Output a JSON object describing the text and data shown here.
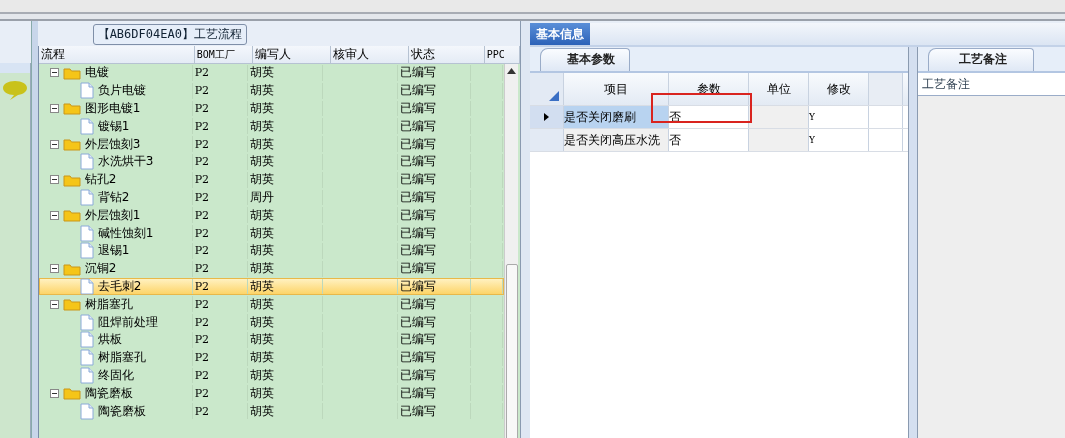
{
  "flow_panel": {
    "title": "【AB6DF04EA0】工艺流程",
    "columns": [
      "流程",
      "BOM工厂",
      "编写人",
      "核审人",
      "状态",
      "PPC"
    ],
    "rows": [
      {
        "name": "电镀",
        "bom": "P2",
        "author": "胡英",
        "status": "已编写",
        "kind": "folder",
        "selected": false,
        "children": [
          {
            "name": "负片电镀",
            "bom": "P2",
            "author": "胡英",
            "status": "已编写",
            "kind": "file",
            "selected": false
          }
        ]
      },
      {
        "name": "图形电镀1",
        "bom": "P2",
        "author": "胡英",
        "status": "已编写",
        "kind": "folder",
        "selected": false,
        "children": [
          {
            "name": "镀锡1",
            "bom": "P2",
            "author": "胡英",
            "status": "已编写",
            "kind": "file",
            "selected": false
          }
        ]
      },
      {
        "name": "外层蚀刻3",
        "bom": "P2",
        "author": "胡英",
        "status": "已编写",
        "kind": "folder",
        "selected": false,
        "children": [
          {
            "name": "水洗烘干3",
            "bom": "P2",
            "author": "胡英",
            "status": "已编写",
            "kind": "file",
            "selected": false
          }
        ]
      },
      {
        "name": "钻孔2",
        "bom": "P2",
        "author": "胡英",
        "status": "已编写",
        "kind": "folder",
        "selected": false,
        "children": [
          {
            "name": "背钻2",
            "bom": "P2",
            "author": "周丹",
            "status": "已编写",
            "kind": "file",
            "selected": false
          }
        ]
      },
      {
        "name": "外层蚀刻1",
        "bom": "P2",
        "author": "胡英",
        "status": "已编写",
        "kind": "folder",
        "selected": false,
        "children": [
          {
            "name": "碱性蚀刻1",
            "bom": "P2",
            "author": "胡英",
            "status": "已编写",
            "kind": "file",
            "selected": false
          },
          {
            "name": "退锡1",
            "bom": "P2",
            "author": "胡英",
            "status": "已编写",
            "kind": "file",
            "selected": false
          }
        ]
      },
      {
        "name": "沉铜2",
        "bom": "P2",
        "author": "胡英",
        "status": "已编写",
        "kind": "folder",
        "selected": false,
        "children": [
          {
            "name": "去毛刺2",
            "bom": "P2",
            "author": "胡英",
            "status": "已编写",
            "kind": "file",
            "selected": true
          }
        ]
      },
      {
        "name": "树脂塞孔",
        "bom": "P2",
        "author": "胡英",
        "status": "已编写",
        "kind": "folder",
        "selected": false,
        "children": [
          {
            "name": "阻焊前处理",
            "bom": "P2",
            "author": "胡英",
            "status": "已编写",
            "kind": "file",
            "selected": false
          },
          {
            "name": "烘板",
            "bom": "P2",
            "author": "胡英",
            "status": "已编写",
            "kind": "file",
            "selected": false
          },
          {
            "name": "树脂塞孔",
            "bom": "P2",
            "author": "胡英",
            "status": "已编写",
            "kind": "file",
            "selected": false
          },
          {
            "name": "终固化",
            "bom": "P2",
            "author": "胡英",
            "status": "已编写",
            "kind": "file",
            "selected": false
          }
        ]
      },
      {
        "name": "陶瓷磨板",
        "bom": "P2",
        "author": "胡英",
        "status": "已编写",
        "kind": "folder",
        "selected": false,
        "children": [
          {
            "name": "陶瓷磨板",
            "bom": "P2",
            "author": "胡英",
            "status": "已编写",
            "kind": "file",
            "selected": false
          }
        ]
      }
    ]
  },
  "info_tab": {
    "label": "基本信息",
    "selected": true
  },
  "params": {
    "tab": {
      "label": "基本参数",
      "selected": true
    },
    "columns": [
      "项目",
      "参数",
      "单位",
      "修改"
    ],
    "rows": [
      {
        "item": "是否关闭磨刷",
        "value": "否",
        "modify": "Y",
        "selected": true
      },
      {
        "item": "是否关闭高压水洗",
        "value": "否",
        "modify": "Y",
        "selected": false
      }
    ]
  },
  "notes": {
    "tab": {
      "label": "工艺备注",
      "selected": true
    },
    "label": "工艺备注"
  }
}
